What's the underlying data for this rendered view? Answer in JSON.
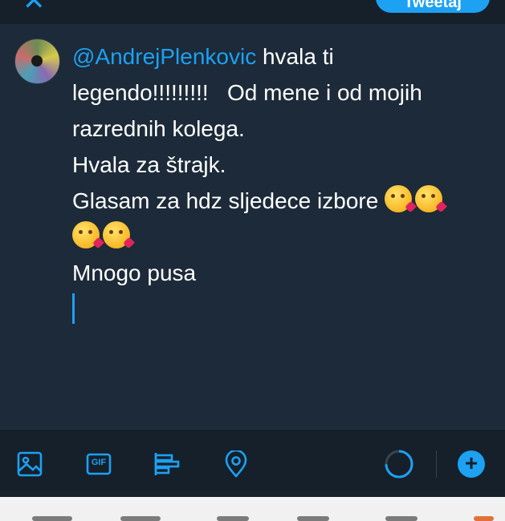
{
  "header": {
    "tweet_label": "Tweetaj"
  },
  "compose": {
    "lines": [
      {
        "mention": "@AndrejPlenkovic",
        "text": " hvala ti"
      },
      {
        "text": "legendo!!!!!!!!!   Od mene i od mojih"
      },
      {
        "text": "razrednih kolega."
      },
      {
        "text": "Hvala za štrajk."
      },
      {
        "text": "Glasam za hdz sljedece izbore "
      },
      {
        "text": "Mnogo pusa"
      }
    ],
    "emoji_name": "face-blowing-a-kiss"
  },
  "toolbar": {
    "icons": [
      "image-icon",
      "gif-icon",
      "poll-icon",
      "location-icon"
    ],
    "gif_label": "GIF",
    "add_label": "+"
  },
  "colors": {
    "accent": "#1da1f2",
    "background": "#15202b",
    "compose_background": "#1c2a39",
    "text": "#ffffff"
  }
}
